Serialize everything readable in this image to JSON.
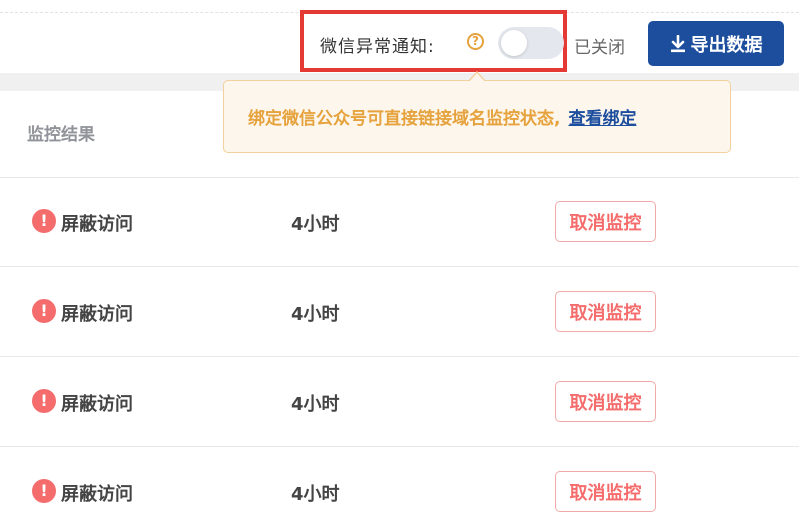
{
  "toolbar": {
    "wechat_label": "微信异常通知:",
    "help_icon": "question-circle-icon",
    "help_glyph": "?",
    "toggle_on": false,
    "toggle_state": "已关闭",
    "export_icon": "download-icon",
    "export_label": "导出数据"
  },
  "tooltip": {
    "text": "绑定微信公众号可直接链接域名监控状态,",
    "link": "查看绑定"
  },
  "table": {
    "header": "监控结果",
    "rows": [
      {
        "status_icon": "alert-circle-icon",
        "status_glyph": "!",
        "status": "屏蔽访问",
        "duration": "4小时",
        "action": "取消监控"
      },
      {
        "status_icon": "alert-circle-icon",
        "status_glyph": "!",
        "status": "屏蔽访问",
        "duration": "4小时",
        "action": "取消监控"
      },
      {
        "status_icon": "alert-circle-icon",
        "status_glyph": "!",
        "status": "屏蔽访问",
        "duration": "4小时",
        "action": "取消监控"
      },
      {
        "status_icon": "alert-circle-icon",
        "status_glyph": "!",
        "status": "屏蔽访问",
        "duration": "4小时",
        "action": "取消监控"
      }
    ]
  },
  "colors": {
    "primary": "#1d4e9e",
    "danger": "#f56c6c",
    "warning": "#e6a23c",
    "highlight": "#e53935"
  }
}
